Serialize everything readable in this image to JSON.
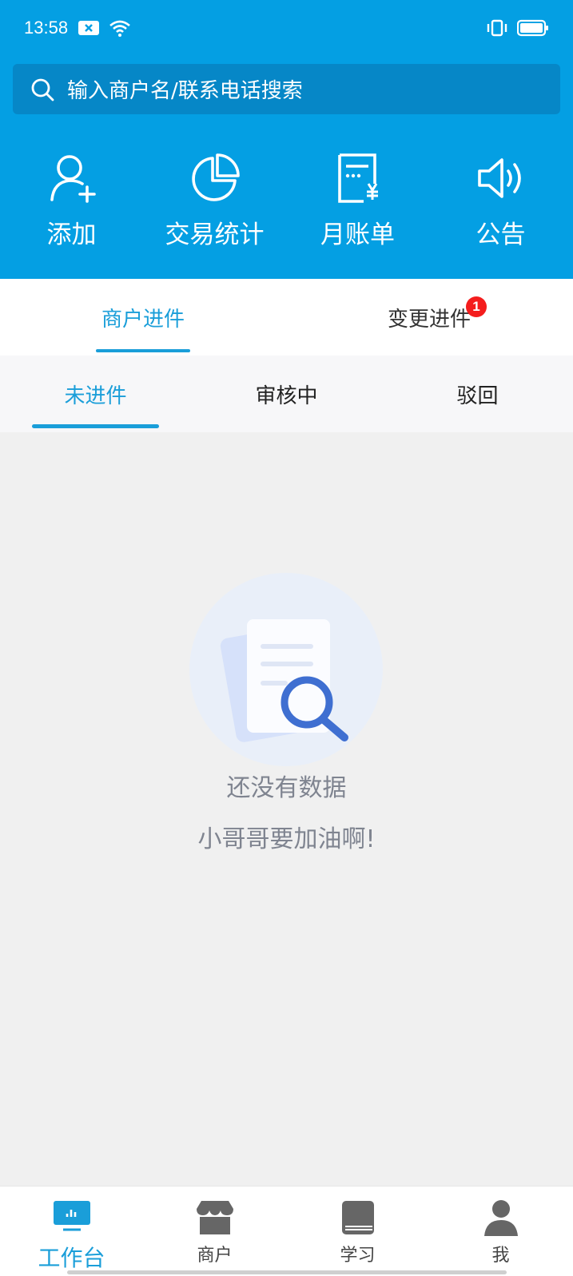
{
  "status_bar": {
    "time": "13:58"
  },
  "search": {
    "placeholder": "输入商户名/联系电话搜索"
  },
  "quick_actions": [
    {
      "label": "添加",
      "icon": "add-user-icon"
    },
    {
      "label": "交易统计",
      "icon": "pie-chart-icon"
    },
    {
      "label": "月账单",
      "icon": "bill-icon"
    },
    {
      "label": "公告",
      "icon": "speaker-icon"
    }
  ],
  "main_tabs": [
    {
      "label": "商户进件",
      "active": true
    },
    {
      "label": "变更进件",
      "active": false,
      "badge": "1"
    }
  ],
  "sub_tabs": [
    {
      "label": "未进件",
      "active": true
    },
    {
      "label": "审核中",
      "active": false
    },
    {
      "label": "驳回",
      "active": false
    }
  ],
  "empty_state": {
    "title": "还没有数据",
    "subtitle": "小哥哥要加油啊!"
  },
  "bottom_nav": [
    {
      "label": "工作台",
      "icon": "dashboard-icon",
      "active": true
    },
    {
      "label": "商户",
      "icon": "store-icon",
      "active": false
    },
    {
      "label": "学习",
      "icon": "book-icon",
      "active": false
    },
    {
      "label": "我",
      "icon": "person-icon",
      "active": false
    }
  ],
  "colors": {
    "header_bg": "#049fe3",
    "accent": "#1a9ed9",
    "badge": "#f41d1d",
    "page_bg": "#f0f0f0"
  }
}
